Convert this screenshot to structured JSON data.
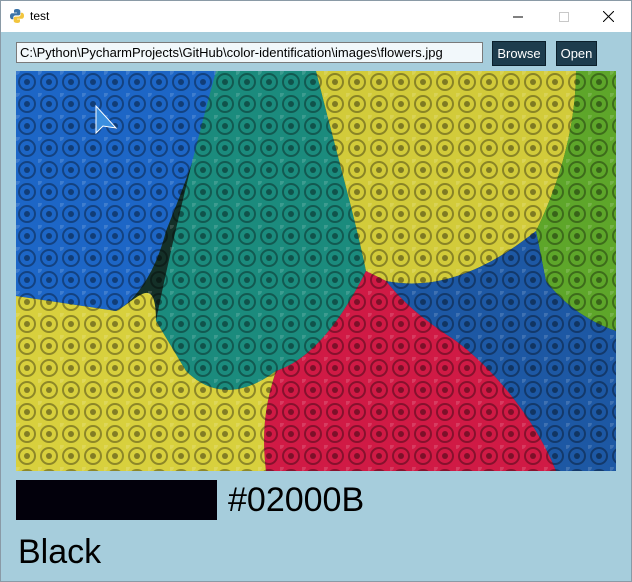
{
  "window": {
    "title": "test",
    "controls": [
      "minimize",
      "maximize",
      "close"
    ]
  },
  "toolbar": {
    "path_value": "C:\\Python\\PycharmProjects\\GitHub\\color-identification\\images\\flowers.jpg",
    "browse_label": "Browse",
    "open_label": "Open"
  },
  "image": {
    "description_icon": "flowers-photo",
    "regions": [
      {
        "name": "blue",
        "color": "#1a64c4"
      },
      {
        "name": "teal",
        "color": "#1a8f80"
      },
      {
        "name": "yellow",
        "color": "#d6cf3a"
      },
      {
        "name": "green",
        "color": "#63a82a"
      },
      {
        "name": "red",
        "color": "#d21842"
      },
      {
        "name": "dark-blue",
        "color": "#1a5aa8"
      },
      {
        "name": "yellow-lower",
        "color": "#d9d13e"
      }
    ]
  },
  "result": {
    "swatch_color": "#02000B",
    "hex_label": "#02000B",
    "color_name": "Black"
  },
  "colors": {
    "background": "#a6cddc",
    "button_bg": "#1d3c4d"
  }
}
